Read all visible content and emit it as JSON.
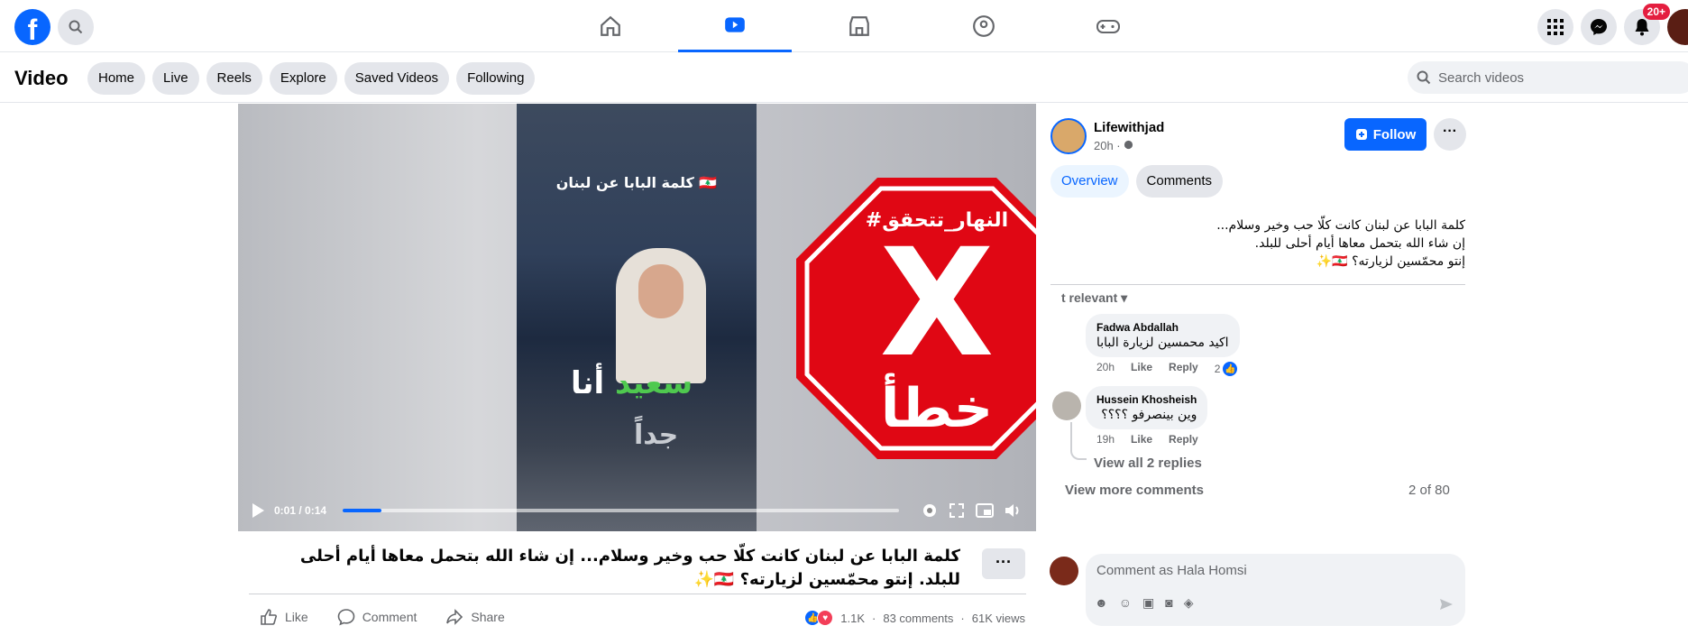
{
  "topbar": {
    "logo": "f",
    "notification_count": "20+",
    "icons": [
      "search-icon",
      "home-icon",
      "video-icon",
      "marketplace-icon",
      "groups-icon",
      "gaming-icon",
      "menu-grid-icon",
      "messenger-icon",
      "bell-icon"
    ]
  },
  "subbar": {
    "title": "Video",
    "pills": [
      "Home",
      "Live",
      "Reels",
      "Explore",
      "Saved Videos",
      "Following"
    ],
    "search_placeholder": "Search videos"
  },
  "video": {
    "caption_overlay": "كلمة البابا عن لبنان 🇱🇧",
    "overlay_line1_white": "أنا",
    "overlay_line1_green": "سعيد",
    "overlay_line2": "جداً",
    "badge_hashtag": "#النهار_تتحقق",
    "badge_mark": "X",
    "badge_word": "خطأ",
    "time": "0:01 / 0:14",
    "progress": 0.07,
    "title": "كلمة البابا عن لبنان كانت كلّا حب وخير وسلام... إن شاء الله بتحمل معاها أيام أحلى للبلد. إنتو محمّسين لزيارته؟ 🇱🇧✨",
    "more": "···"
  },
  "actions": {
    "like": "Like",
    "comment": "Comment",
    "share": "Share",
    "reactions": "1.1K",
    "comments": "83 comments",
    "views": "61K views"
  },
  "panel": {
    "author": "Lifewithjad",
    "time": "20h · ",
    "follow": "Follow",
    "more": "···",
    "tabs": [
      "Overview",
      "Comments"
    ],
    "desc_lines": [
      "كلمة البابا عن لبنان كانت كلّا حب وخير وسلام...",
      "إن شاء الله بتحمل معاها أيام أحلى للبلد.",
      "إنتو محمّسين لزيارته؟ 🇱🇧✨"
    ],
    "sort": "t relevant",
    "comments": [
      {
        "author": "Fadwa Abdallah",
        "text": "اكيد محمسين لزيارة البابا",
        "time": "20h",
        "like": "Like",
        "reply": "Reply",
        "reactions": "2"
      },
      {
        "author": "Hussein Khosheish",
        "text": "وين بينصرفو ؟؟؟؟",
        "time": "19h",
        "like": "Like",
        "reply": "Reply"
      }
    ],
    "view_replies": "View all 2 replies",
    "view_more": "View more comments",
    "count": "2 of 80",
    "composer_placeholder": "Comment as Hala Homsi"
  }
}
